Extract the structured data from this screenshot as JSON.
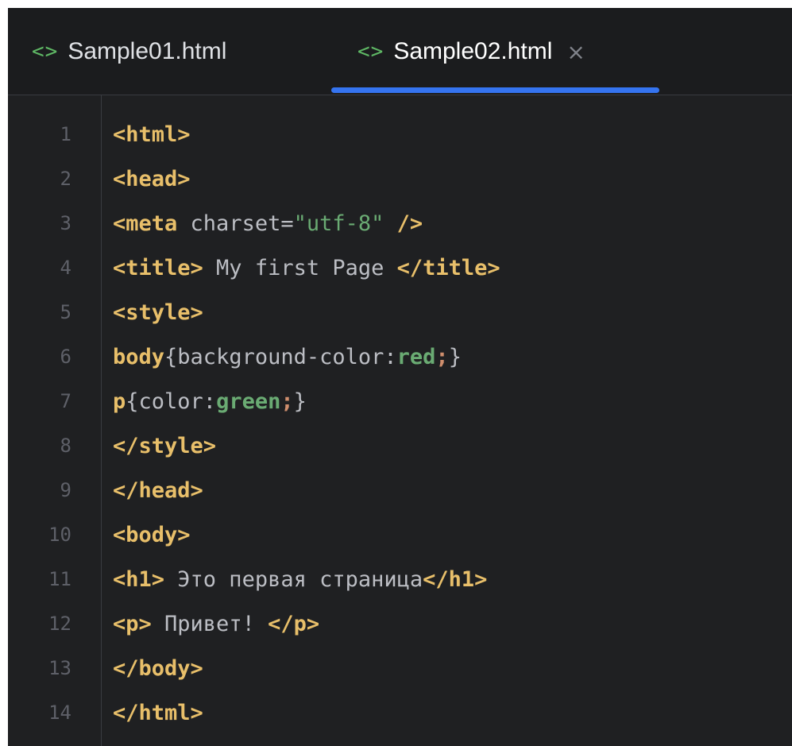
{
  "tabs": [
    {
      "icon": "<>",
      "label": "Sample01.html"
    },
    {
      "icon": "<>",
      "label": "Sample02.html",
      "close": "×",
      "active": true
    }
  ],
  "editor": {
    "lines": [
      {
        "n": "1",
        "tokens": [
          {
            "t": "tag",
            "v": "<html>"
          }
        ]
      },
      {
        "n": "2",
        "tokens": [
          {
            "t": "tag",
            "v": "<head>"
          }
        ]
      },
      {
        "n": "3",
        "tokens": [
          {
            "t": "tag",
            "v": "<meta "
          },
          {
            "t": "attr",
            "v": "charset="
          },
          {
            "t": "str",
            "v": "\"utf-8\""
          },
          {
            "t": "tag",
            "v": " />"
          }
        ]
      },
      {
        "n": "4",
        "tokens": [
          {
            "t": "tag",
            "v": "<title>"
          },
          {
            "t": "txt",
            "v": " My first Page "
          },
          {
            "t": "tag",
            "v": "</title>"
          }
        ]
      },
      {
        "n": "5",
        "tokens": [
          {
            "t": "tag",
            "v": "<style>"
          }
        ]
      },
      {
        "n": "6",
        "tokens": [
          {
            "t": "sel",
            "v": "body"
          },
          {
            "t": "brace",
            "v": "{"
          },
          {
            "t": "prop",
            "v": "background-color:"
          },
          {
            "t": "val",
            "v": "red"
          },
          {
            "t": "punc",
            "v": ";"
          },
          {
            "t": "brace",
            "v": "}"
          }
        ]
      },
      {
        "n": "7",
        "tokens": [
          {
            "t": "sel",
            "v": "p"
          },
          {
            "t": "brace",
            "v": "{"
          },
          {
            "t": "prop",
            "v": "color:"
          },
          {
            "t": "val",
            "v": "green"
          },
          {
            "t": "punc",
            "v": ";"
          },
          {
            "t": "brace",
            "v": "}"
          }
        ]
      },
      {
        "n": "8",
        "tokens": [
          {
            "t": "tag",
            "v": "</style>"
          }
        ]
      },
      {
        "n": "9",
        "tokens": [
          {
            "t": "tag",
            "v": "</head>"
          }
        ]
      },
      {
        "n": "10",
        "tokens": [
          {
            "t": "tag",
            "v": "<body>"
          }
        ]
      },
      {
        "n": "11",
        "tokens": [
          {
            "t": "tag",
            "v": "<h1>"
          },
          {
            "t": "txt",
            "v": " Это первая страница"
          },
          {
            "t": "tag",
            "v": "</h1>"
          }
        ]
      },
      {
        "n": "12",
        "tokens": [
          {
            "t": "tag",
            "v": "<p>"
          },
          {
            "t": "txt",
            "v": " Привет! "
          },
          {
            "t": "tag",
            "v": "</p>"
          }
        ]
      },
      {
        "n": "13",
        "tokens": [
          {
            "t": "tag",
            "v": "</body>"
          }
        ]
      },
      {
        "n": "14",
        "tokens": [
          {
            "t": "tag",
            "v": "</html>"
          }
        ]
      }
    ]
  },
  "colors": {
    "background": "#1f2022",
    "tag": "#e8bf6a",
    "string": "#6aab73",
    "text": "#bcbec4",
    "line_number": "#5e6068",
    "active_tab_underline": "#3574f0"
  }
}
